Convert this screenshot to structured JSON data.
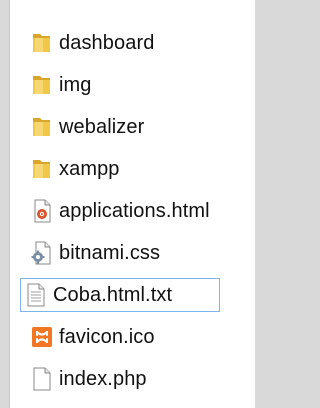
{
  "files": [
    {
      "name": "dashboard",
      "icon": "folder-icon",
      "type": "folder"
    },
    {
      "name": "img",
      "icon": "folder-icon",
      "type": "folder"
    },
    {
      "name": "webalizer",
      "icon": "folder-icon",
      "type": "folder"
    },
    {
      "name": "xampp",
      "icon": "folder-icon",
      "type": "folder"
    },
    {
      "name": "applications.html",
      "icon": "html-file-icon",
      "type": "file"
    },
    {
      "name": "bitnami.css",
      "icon": "css-file-icon",
      "type": "file"
    },
    {
      "name": "Coba.html.txt",
      "icon": "text-file-icon",
      "type": "file",
      "selected": true
    },
    {
      "name": "favicon.ico",
      "icon": "xampp-icon",
      "type": "file"
    },
    {
      "name": "index.php",
      "icon": "blank-file-icon",
      "type": "file"
    }
  ],
  "colors": {
    "folder": "#e8b93a",
    "selection_border": "#7eb4ea",
    "xampp_orange": "#f37623"
  }
}
